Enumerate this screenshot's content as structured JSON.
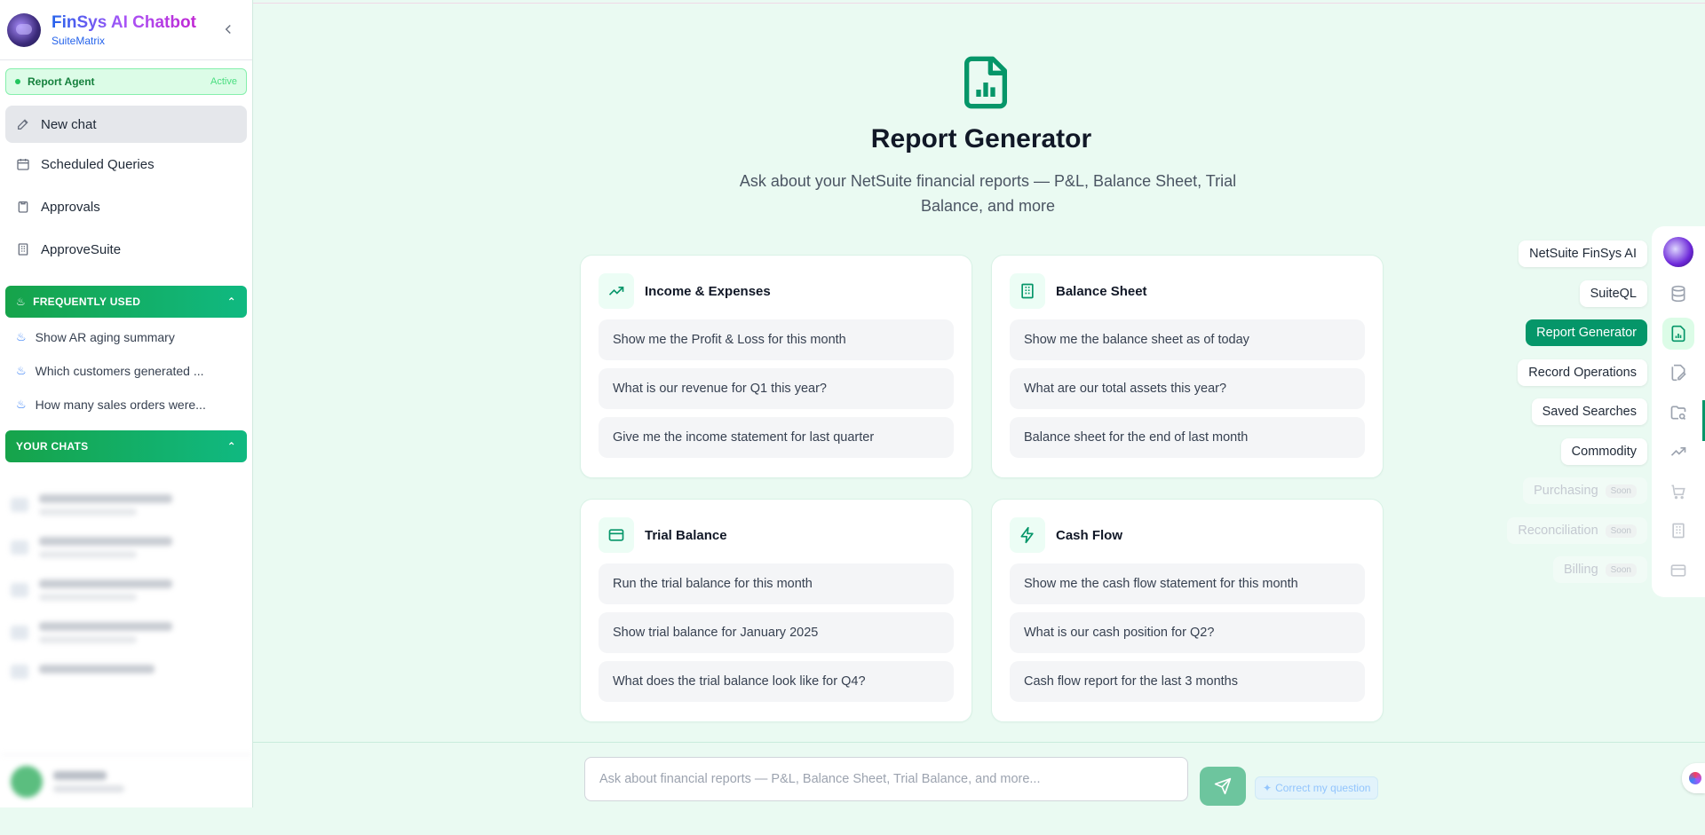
{
  "brand": {
    "title": "FinSys AI Chatbot",
    "subtitle": "SuiteMatrix"
  },
  "agent": {
    "name": "Report Agent",
    "status": "Active"
  },
  "nav": [
    {
      "label": "New chat",
      "icon": "edit-icon"
    },
    {
      "label": "Scheduled Queries",
      "icon": "calendar-clock-icon"
    },
    {
      "label": "Approvals",
      "icon": "clipboard-icon"
    },
    {
      "label": "ApproveSuite",
      "icon": "building-icon"
    }
  ],
  "frequent": {
    "header": "FREQUENTLY USED",
    "items": [
      "Show AR aging summary",
      "Which customers generated ...",
      "How many sales orders were..."
    ]
  },
  "chats": {
    "header": "YOUR CHATS"
  },
  "hero": {
    "title": "Report Generator",
    "subtitle": "Ask about your NetSuite financial reports — P&L, Balance Sheet, Trial Balance, and more"
  },
  "cards": [
    {
      "title": "Income & Expenses",
      "icon": "trending-up-icon",
      "prompts": [
        "Show me the Profit & Loss for this month",
        "What is our revenue for Q1 this year?",
        "Give me the income statement for last quarter"
      ]
    },
    {
      "title": "Balance Sheet",
      "icon": "building-icon",
      "prompts": [
        "Show me the balance sheet as of today",
        "What are our total assets this year?",
        "Balance sheet for the end of last month"
      ]
    },
    {
      "title": "Trial Balance",
      "icon": "credit-card-icon",
      "prompts": [
        "Run the trial balance for this month",
        "Show trial balance for January 2025",
        "What does the trial balance look like for Q4?"
      ]
    },
    {
      "title": "Cash Flow",
      "icon": "lightning-icon",
      "prompts": [
        "Show me the cash flow statement for this month",
        "What is our cash position for Q2?",
        "Cash flow report for the last 3 months"
      ]
    }
  ],
  "tools": [
    {
      "label": "NetSuite FinSys AI",
      "state": "normal",
      "icon": "avatar-icon"
    },
    {
      "label": "SuiteQL",
      "state": "normal",
      "icon": "database-icon"
    },
    {
      "label": "Report Generator",
      "state": "active",
      "icon": "report-file-icon"
    },
    {
      "label": "Record Operations",
      "state": "normal",
      "icon": "file-edit-icon"
    },
    {
      "label": "Saved Searches",
      "state": "normal",
      "icon": "folder-search-icon"
    },
    {
      "label": "Commodity",
      "state": "normal",
      "icon": "trending-up-icon"
    },
    {
      "label": "Purchasing",
      "state": "soon",
      "icon": "cart-icon"
    },
    {
      "label": "Reconciliation",
      "state": "soon",
      "icon": "building-icon"
    },
    {
      "label": "Billing",
      "state": "soon",
      "icon": "credit-card-icon"
    }
  ],
  "soon_label": "Soon",
  "input": {
    "placeholder": "Ask about financial reports — P&L, Balance Sheet, Trial Balance, and more..."
  },
  "correct_label": "Correct my question",
  "colors": {
    "accent": "#059669",
    "background": "#eafaf2",
    "brand_gradient": [
      "#2563eb",
      "#c026d3"
    ]
  }
}
